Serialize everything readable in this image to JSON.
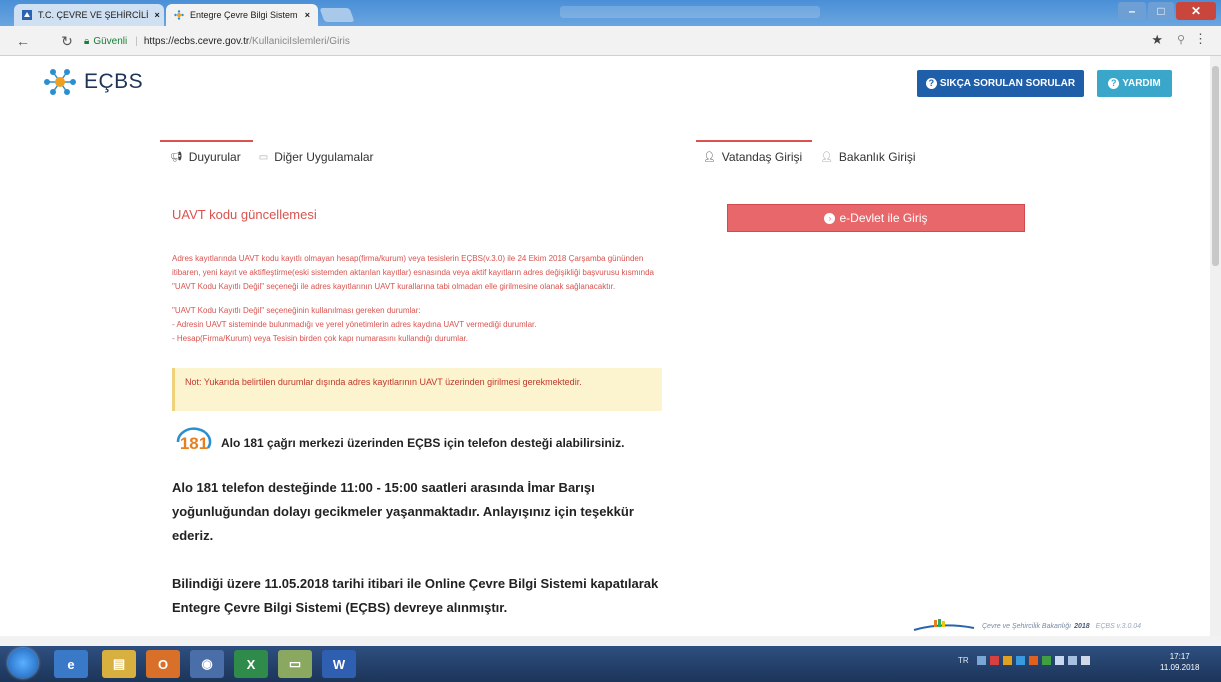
{
  "browser": {
    "tabs": [
      {
        "label": "T.C. ÇEVRE VE ŞEHİRCİLİ",
        "close": "×",
        "active": false
      },
      {
        "label": "Entegre Çevre Bilgi Sistem",
        "close": "×",
        "active": true
      }
    ],
    "security_label": "Güvenli",
    "url_host": "https://ecbs.cevre.gov.tr",
    "url_path": "/KullaniciIslemleri/Giris",
    "back_icon": "back-arrow-icon",
    "reload_icon": "reload-icon",
    "star_icon": "bookmark-star-icon",
    "menu_icon": "kebab-menu-icon"
  },
  "header": {
    "logo_text": "EÇBS",
    "faq_button": "SIKÇA SORULAN SORULAR",
    "help_button": "YARDIM",
    "faq_color": "#1f5ea8",
    "help_color": "#3aa6c9"
  },
  "left_tabs": [
    {
      "label": "Duyurular",
      "icon": "megaphone-icon"
    },
    {
      "label": "Diğer Uygulamalar",
      "icon": "window-icon"
    }
  ],
  "right_tabs": [
    {
      "label": "Vatandaş Girişi",
      "icon": "user-icon"
    },
    {
      "label": "Bakanlık Girişi",
      "icon": "user-icon"
    }
  ],
  "announcement": {
    "title": "UAVT kodu güncellemesi",
    "paragraph1": "Adres kayıtlarında UAVT kodu kayıtlı olmayan hesap(firma/kurum) veya tesislerin EÇBS(v.3.0) ile 24 Ekim 2018 Çarşamba gününden itibaren, yeni kayıt ve aktifleştirme(eski sistemden aktarılan kayıtlar) esnasında veya aktif kayıtların adres değişikliği başvurusu kısmında \"UAVT Kodu Kayıtlı Değil\" seçeneği ile adres kayıtlarının UAVT kurallarına tabi olmadan elle girilmesine olanak sağlanacaktır.",
    "paragraph2_title": "\"UAVT Kodu Kayıtlı Değil\" seçeneğinin kullanılması gereken durumlar:",
    "paragraph2_item1": "- Adresin UAVT sisteminde bulunmadığı ve yerel yönetimlerin adres kaydına UAVT vermediği durumlar.",
    "paragraph2_item2": "- Hesap(Firma/Kurum) veya Tesisin birden çok kapı numarasını kullandığı durumlar.",
    "note": "Not: Yukarıda belirtilen durumlar dışında adres kayıtlarının UAVT üzerinden girilmesi gerekmektedir."
  },
  "alo181": {
    "badge": "181",
    "text": "Alo 181 çağrı merkezi üzerinden EÇBS için telefon desteği alabilirsiniz."
  },
  "notices": {
    "p1": "Alo 181 telefon desteğinde 11:00 - 15:00 saatleri arasında İmar Barışı yoğunluğundan dolayı gecikmeler yaşanmaktadır. Anlayışınız için teşekkür ederiz.",
    "p2": "Bilindiği üzere 11.05.2018 tarihi itibari ile Online Çevre Bilgi Sistemi kapatılarak Entegre Çevre Bilgi Sistemi (EÇBS) devreye alınmıştır."
  },
  "login": {
    "edevlet_button": "e-Devlet ile Giriş",
    "edevlet_color": "#e8676b"
  },
  "footer": {
    "ministry": "Çevre ve Şehircilik Bakanlığı",
    "year": "2018",
    "version": "EÇBS v.3.0.04"
  },
  "taskbar": {
    "lang": "TR",
    "time": "17:17",
    "date": "11.09.2018"
  }
}
